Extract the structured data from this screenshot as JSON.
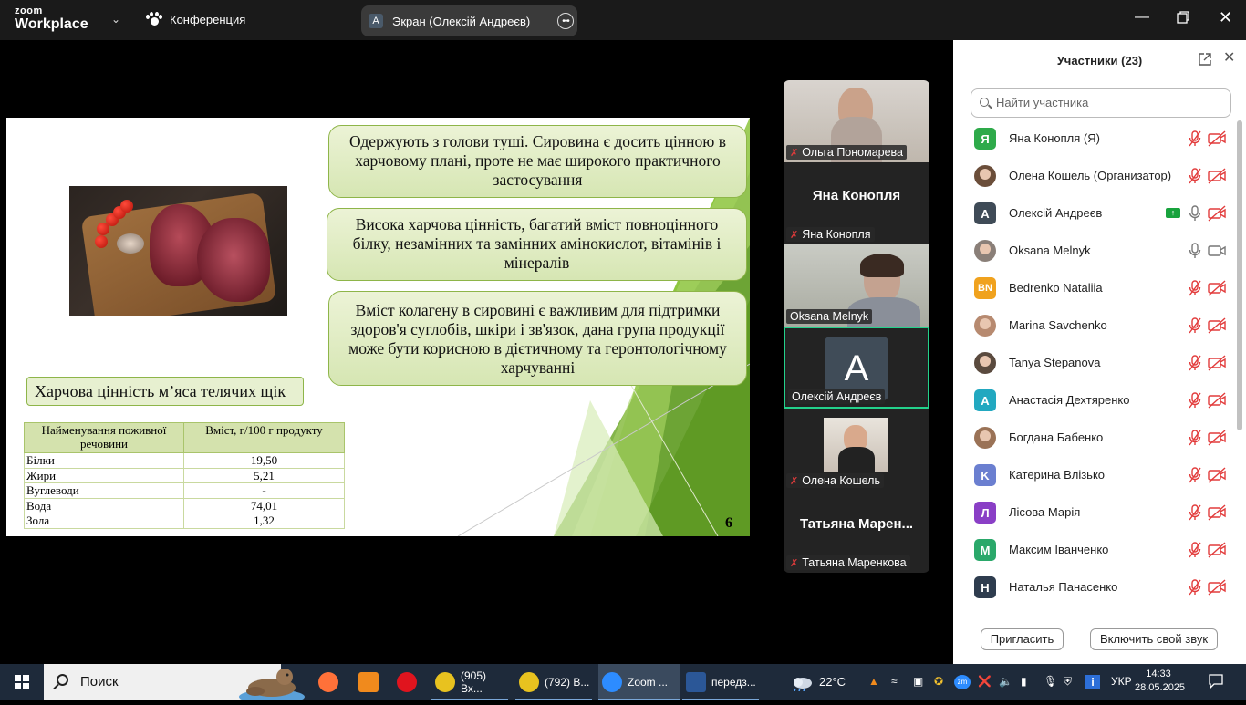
{
  "topbar": {
    "logo_line1": "zoom",
    "logo_line2": "Workplace",
    "conference_label": "Конференция",
    "screen_share_avatar": "A",
    "screen_share_label": "Экран (Олексій Андреєв)",
    "more_label": "•••"
  },
  "slide": {
    "box1": "Одержують з голови туші. Сировина є досить цінною в харчовому плані, проте не має широкого практичного застосування",
    "box2": "Висока харчова цінність, багатий вміст повноцінного білку, незамінних та замінних амінокислот, вітамінів і мінералів",
    "box3": "Вміст колагену в сировині є важливим для підтримки здоров'я суглобів, шкіри і зв'язок, дана група продукції може бути корисною в дієтичному та геронтологічному харчуванні",
    "caption": "Харчова цінність м’яса телячих щік",
    "table": {
      "headers": [
        "Найменування поживної речовини",
        "Вміст, г/100 г продукту"
      ],
      "rows": [
        [
          "Білки",
          "19,50"
        ],
        [
          "Жири",
          "5,21"
        ],
        [
          "Вуглеводи",
          "-"
        ],
        [
          "Вода",
          "74,01"
        ],
        [
          "Зола",
          "1,32"
        ]
      ]
    },
    "page_number": "6",
    "accent_color": "#8dc63f"
  },
  "videos": [
    {
      "name": "Ольга Пономарева",
      "muted": true
    },
    {
      "name": "Яна Конопля",
      "title": "Яна Конопля",
      "muted": true
    },
    {
      "name": "Oksana Melnyk",
      "muted": false
    },
    {
      "name": "Олексій Андреєв",
      "avatar": "A",
      "muted": false,
      "active": true
    },
    {
      "name": "Олена Кошель",
      "muted": true
    },
    {
      "name": "Татьяна Маренкова",
      "title": "Татьяна  Марен...",
      "muted": true
    }
  ],
  "panel": {
    "title": "Участники (23)",
    "search_placeholder": "Найти участника",
    "participants": [
      {
        "name": "Яна Конопля (Я)",
        "avatar": "Я",
        "color": "#2eaa4a",
        "mic": "muted",
        "cam": "off"
      },
      {
        "name": "Олена Кошель (Организатор)",
        "avatar": "",
        "color": "#6b4e3a",
        "mic": "muted",
        "cam": "off"
      },
      {
        "name": "Олексій Андреєв",
        "avatar": "A",
        "color": "#3f4b57",
        "mic": "on",
        "cam": "off",
        "sharing": true
      },
      {
        "name": "Oksana Melnyk",
        "avatar": "",
        "color": "#8a7f78",
        "mic": "on",
        "cam": "on"
      },
      {
        "name": "Bedrenko Nataliia",
        "avatar": "BN",
        "color": "#f0a21e",
        "mic": "muted",
        "cam": "off"
      },
      {
        "name": "Marina Savchenko",
        "avatar": "",
        "color": "#b78a70",
        "mic": "muted",
        "cam": "off"
      },
      {
        "name": "Tanya Stepanova",
        "avatar": "",
        "color": "#5a4a3e",
        "mic": "muted",
        "cam": "off"
      },
      {
        "name": "Анастасія Дехтяренко",
        "avatar": "A",
        "color": "#22a8c0",
        "mic": "muted",
        "cam": "off"
      },
      {
        "name": "Богдана Бабенко",
        "avatar": "",
        "color": "#9a7256",
        "mic": "muted",
        "cam": "off"
      },
      {
        "name": "Катерина Влізько",
        "avatar": "K",
        "color": "#6b7fd0",
        "mic": "muted",
        "cam": "off"
      },
      {
        "name": "Лісова Марія",
        "avatar": "Л",
        "color": "#8a3fc6",
        "mic": "muted",
        "cam": "off"
      },
      {
        "name": "Максим Іванченко",
        "avatar": "M",
        "color": "#2aa86a",
        "mic": "muted",
        "cam": "off"
      },
      {
        "name": "Наталья Панасенко",
        "avatar": "H",
        "color": "#2e3c4e",
        "mic": "muted",
        "cam": "off"
      }
    ],
    "invite_label": "Пригласить",
    "unmute_label": "Включить свой звук"
  },
  "taskbar": {
    "search_label": "Поиск",
    "apps": [
      {
        "label": "",
        "icon": "firefox-icon",
        "color": "#ff7139"
      },
      {
        "label": "",
        "icon": "app-g-icon",
        "color": "#f08a1d"
      },
      {
        "label": "",
        "icon": "opera-icon",
        "color": "#e0141e"
      },
      {
        "label": "(905) Вх...",
        "icon": "chrome-icon",
        "color": "#e8c21f"
      },
      {
        "label": "(792) В...",
        "icon": "chrome-icon",
        "color": "#e8c21f"
      },
      {
        "label": "Zoom ...",
        "icon": "zoom-icon",
        "color": "#2d8cff",
        "active": true
      },
      {
        "label": "передз...",
        "icon": "word-icon",
        "color": "#2b5797"
      }
    ],
    "weather": "22°C",
    "language": "УКР",
    "time": "14:33",
    "date": "28.05.2025"
  }
}
